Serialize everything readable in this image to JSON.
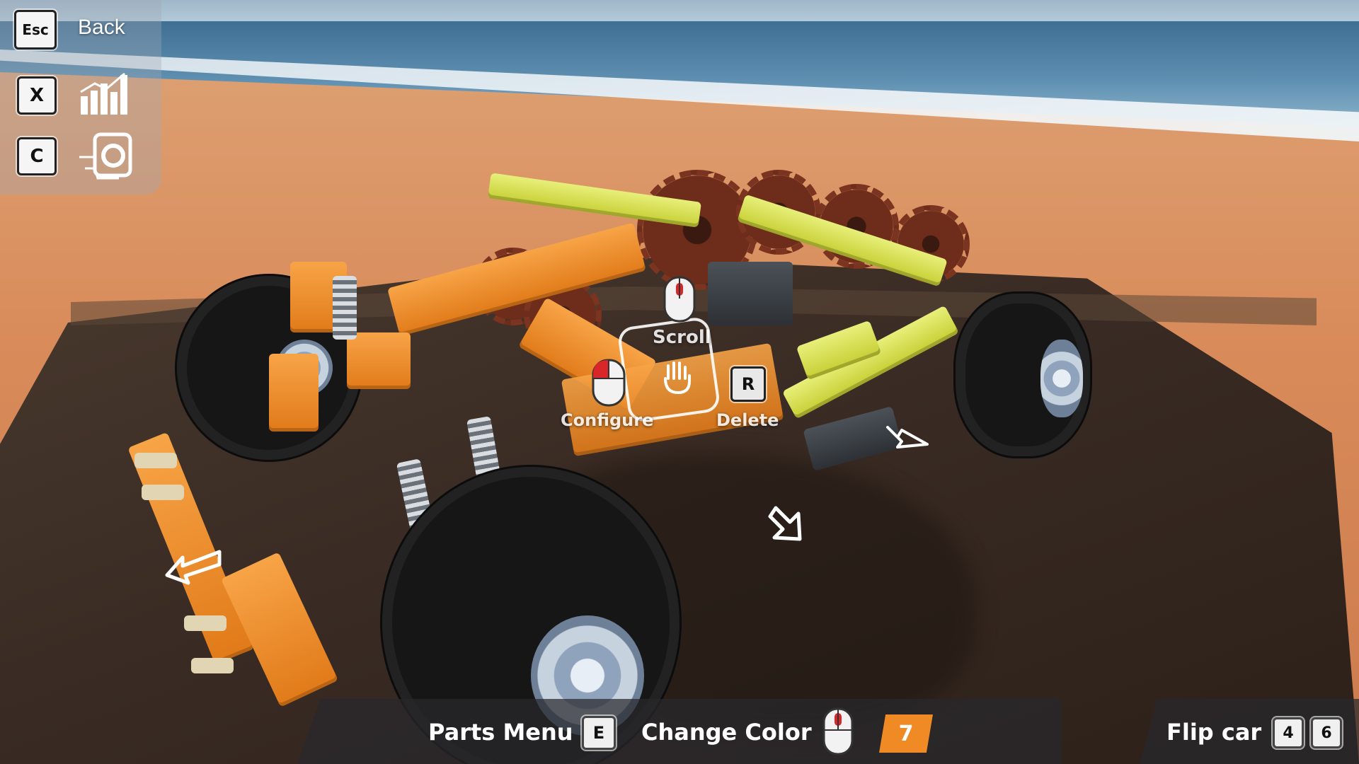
{
  "hud": {
    "back_key": "Esc",
    "back_label": "Back",
    "stats_key": "X",
    "camera_key": "C"
  },
  "context_menu": {
    "scroll_label": "Scroll",
    "configure_label": "Configure",
    "delete_key": "R",
    "delete_label": "Delete"
  },
  "bottom_bar": {
    "parts_menu_label": "Parts Menu",
    "parts_menu_key": "E",
    "change_color_label": "Change Color",
    "color_index": "7",
    "flip_car_label": "Flip car",
    "flip_key_left": "4",
    "flip_key_right": "6"
  },
  "colors": {
    "accent": "#f08a24",
    "part_orange": "#e8841f",
    "part_yellow": "#d6de45",
    "mouse_button_red": "#d8262a"
  },
  "icons": {
    "stats": "bar-chart-icon",
    "camera": "camera-icon",
    "mouse": "mouse-icon",
    "hand": "hand-grab-icon"
  }
}
